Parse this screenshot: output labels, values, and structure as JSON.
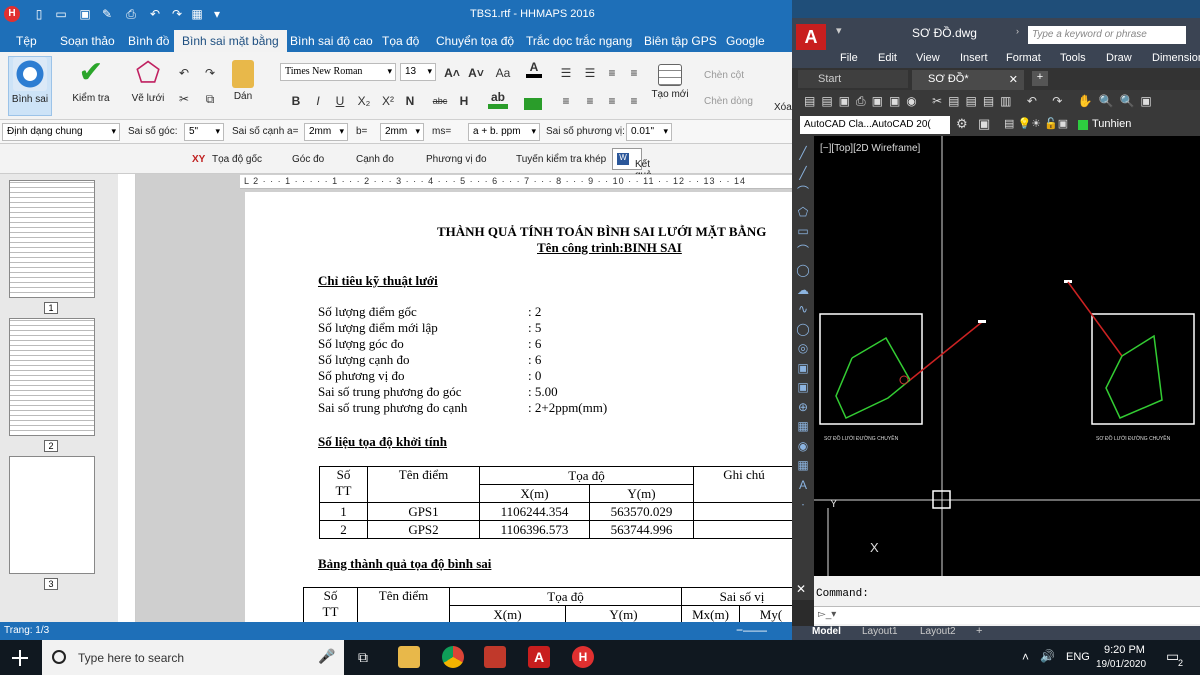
{
  "hhmaps": {
    "title": "TBS1.rtf - HHMAPS  2016",
    "menu": [
      "Tệp",
      "Soạn thảo",
      "Bình đồ",
      "Bình sai mặt bằng",
      "Bình sai độ cao",
      "Tọa độ",
      "Chuyển tọa độ",
      "Trắc dọc trắc ngang",
      "Biên tập GPS",
      "Google maps"
    ],
    "active_menu": "Bình sai mặt bằng",
    "ribbon": {
      "binh_sai": "Bình sai",
      "kiem_tra": "Kiểm tra",
      "ve_luoi": "Vẽ lưới",
      "dan": "Dán",
      "font": "Times New Roman",
      "size": "13",
      "tao_moi": "Tạo mới",
      "chen_cot": "Chèn cột",
      "chen_dong": "Chèn dòng",
      "xoa": "Xóa"
    },
    "format_bar": {
      "dinh_dang": "Định dạng chung",
      "sai_so_goc_label": "Sai số góc:",
      "sai_so_goc": "5\"",
      "sai_so_canh_label": "Sai số cạnh a=",
      "a_val": "2mm",
      "b_label": "b=",
      "b_val": "2mm",
      "ms_label": "ms=",
      "ms_val": "a + b. ppm",
      "sspv_label": "Sai số phương vị:",
      "sspv_val": "0.01\""
    },
    "tabs": [
      "Tọa độ gốc",
      "Góc đo",
      "Cạnh đo",
      "Phương vị đo",
      "Tuyến kiểm tra khép",
      "Kết quả"
    ],
    "thumb_pages": [
      "1",
      "2",
      "3"
    ],
    "status": "Trang: 1/3",
    "document": {
      "title": "THÀNH QUẢ TÍNH TOÁN BÌNH SAI LƯỚI MẶT BẰNG",
      "subtitle": "Tên công trình:BINH SAI",
      "section1": "Chỉ tiêu kỹ thuật lưới",
      "specs": [
        {
          "label": "Số lượng điểm gốc",
          "value": ": 2"
        },
        {
          "label": "Số lượng điểm mới lập",
          "value": ": 5"
        },
        {
          "label": "Số lượng góc đo",
          "value": ": 6"
        },
        {
          "label": "Số lượng cạnh đo",
          "value": ": 6"
        },
        {
          "label": "Số phương vị đo",
          "value": ": 0"
        },
        {
          "label": "Sai số trung phương đo góc",
          "value": ": 5.00"
        },
        {
          "label": "Sai số trung phương đo cạnh",
          "value": ": 2+2ppm(mm)"
        }
      ],
      "section2": "Số liệu tọa độ khởi tính",
      "t1_head": {
        "so": "Số",
        "tt": "TT",
        "ten": "Tên điểm",
        "toado": "Tọa độ",
        "x": "X(m)",
        "y": "Y(m)",
        "ghichu": "Ghi chú"
      },
      "t1_rows": [
        {
          "tt": "1",
          "ten": "GPS1",
          "x": "1106244.354",
          "y": "563570.029"
        },
        {
          "tt": "2",
          "ten": "GPS2",
          "x": "1106396.573",
          "y": "563744.996"
        }
      ],
      "section3": "Bảng thành quả tọa độ bình sai",
      "t2_head": {
        "so": "Số",
        "tt": "TT",
        "ten": "Tên điểm",
        "toado": "Tọa độ",
        "x": "X(m)",
        "y": "Y(m)",
        "saiso": "Sai số vị",
        "mx": "Mx(m)",
        "my": "My("
      }
    }
  },
  "autocad": {
    "file_title": "SƠ ĐỒ.dwg",
    "search_placeholder": "Type a keyword or phrase",
    "menu": [
      "File",
      "Edit",
      "View",
      "Insert",
      "Format",
      "Tools",
      "Draw",
      "Dimension"
    ],
    "tabs": [
      "Start",
      "SƠ ĐỒ*"
    ],
    "workspace": "AutoCAD Cla...AutoCAD 20(",
    "layer": "Tunhien",
    "viewport_label": "[−][Top][2D Wireframe]",
    "diagram_label_left": "SƠ ĐỒ LƯỚI ĐƯỜNG CHUYỀN",
    "diagram_label_right": "SƠ ĐỒ LƯỚI ĐƯỜNG CHUYỀN",
    "command_label": "Command:",
    "layout_tabs": [
      "Model",
      "Layout1",
      "Layout2"
    ]
  },
  "taskbar": {
    "search_placeholder": "Type here to search",
    "lang": "ENG",
    "time": "9:20 PM",
    "date": "19/01/2020",
    "notif_count": "2"
  }
}
